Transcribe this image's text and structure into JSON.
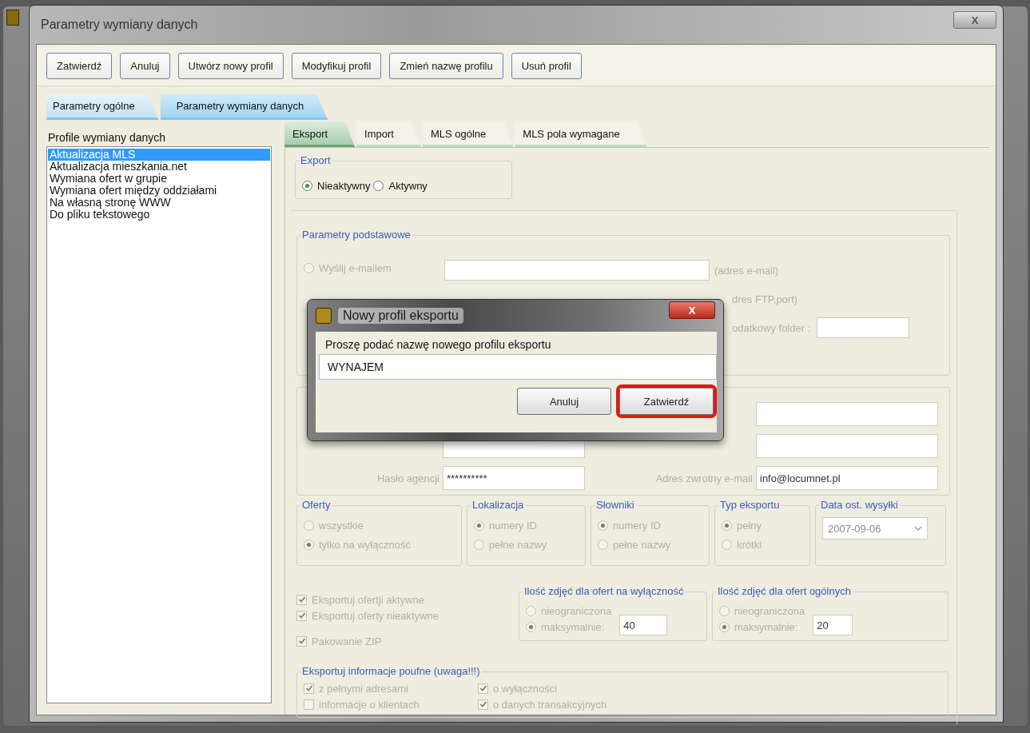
{
  "window": {
    "title": "Parametry wymiany danych",
    "close": "X"
  },
  "toolbar": [
    {
      "label": "Zatwierdź"
    },
    {
      "label": "Anuluj"
    },
    {
      "label": "Utwórz nowy profil"
    },
    {
      "label": "Modyfikuj profil"
    },
    {
      "label": "Zmień nazwę profilu"
    },
    {
      "label": "Usuń profil"
    }
  ],
  "main_tabs": [
    {
      "label": "Parametry ogólne",
      "selected": false
    },
    {
      "label": "Parametry wymiany danych",
      "selected": true
    }
  ],
  "profiles": {
    "title": "Profile wymiany danych",
    "items": [
      {
        "label": "Aktualizacja MLS",
        "selected": true
      },
      {
        "label": "Aktualizacja mieszkania.net",
        "selected": false
      },
      {
        "label": "Wymiana ofert w grupie",
        "selected": false
      },
      {
        "label": "Wymiana ofert między oddziałami",
        "selected": false
      },
      {
        "label": "Na własną stronę WWW",
        "selected": false
      },
      {
        "label": "Do pliku tekstowego",
        "selected": false
      }
    ]
  },
  "sub_tabs": [
    {
      "label": "Eksport",
      "selected": true
    },
    {
      "label": "Import",
      "selected": false
    },
    {
      "label": "MLS ogólne",
      "selected": false
    },
    {
      "label": "MLS pola wymagane",
      "selected": false
    }
  ],
  "export_group": {
    "title": "Export",
    "options": [
      {
        "label": "Nieaktywny",
        "selected": true
      },
      {
        "label": "Aktywny",
        "selected": false
      }
    ]
  },
  "settings": {
    "disabled": true,
    "basic": {
      "title": "Parametry podstawowe",
      "email_option": {
        "label": "Wyślij e-mailem",
        "selected": false
      },
      "email_hint": "(adres e-mail)",
      "ftp_hint": "dres FTP,port)",
      "folder_label": "odatkowy folder :"
    },
    "login": {
      "password_label": "Hasło agencji",
      "password_value": "**********",
      "return_email_label": "Adres zwrotny e-mail",
      "return_email_value": "info@locumnet.pl"
    },
    "groups": [
      {
        "title": "Oferty",
        "options": [
          {
            "label": "wszystkie",
            "selected": false
          },
          {
            "label": "tylko na wyłączność",
            "selected": true
          }
        ]
      },
      {
        "title": "Lokalizacja",
        "options": [
          {
            "label": "numery ID",
            "selected": true
          },
          {
            "label": "pełne nazwy",
            "selected": false
          }
        ]
      },
      {
        "title": "Słowniki",
        "options": [
          {
            "label": "numery ID",
            "selected": true
          },
          {
            "label": "pełne nazwy",
            "selected": false
          }
        ]
      },
      {
        "title": "Typ eksportu",
        "options": [
          {
            "label": "pełny",
            "selected": true
          },
          {
            "label": "krótki",
            "selected": false
          }
        ]
      }
    ],
    "last_sent": {
      "title": "Data ost. wysyłki",
      "value": "2007-09-06"
    },
    "export_checks": [
      {
        "label": "Eksportuj ofertji aktywne",
        "checked": true
      },
      {
        "label": "Eksportuj oferty nieaktywne",
        "checked": true
      },
      {
        "label": "Pakowanie ZIP",
        "checked": true
      }
    ],
    "photo_groups": [
      {
        "title": "Ilość zdjęć dla ofert na wyłączność",
        "options": [
          {
            "label": "nieograniczona",
            "selected": false
          },
          {
            "label": "maksymalnie:",
            "selected": true
          }
        ],
        "value": "40"
      },
      {
        "title": "Ilość zdjęć dla ofert ogólnych",
        "options": [
          {
            "label": "nieograniczona",
            "selected": false
          },
          {
            "label": "maksymalnie:",
            "selected": true
          }
        ],
        "value": "20"
      }
    ],
    "confidential": {
      "title": "Eksportuj informacje poufne (uwaga!!!)",
      "checks": [
        {
          "label": "z pełnymi adresami",
          "checked": true
        },
        {
          "label": "o wyłączności",
          "checked": true
        },
        {
          "label": "informacje o klientach",
          "checked": false
        },
        {
          "label": "o danych transakcyjnych",
          "checked": true
        }
      ]
    }
  },
  "dialog": {
    "title": "Nowy profil eksportu",
    "close": "X",
    "prompt": "Proszę podać nazwę nowego profilu eksportu",
    "value": "WYNAJEM",
    "buttons": [
      {
        "label": "Anuluj",
        "highlighted": false
      },
      {
        "label": "Zatwierdź",
        "highlighted": true
      }
    ]
  }
}
